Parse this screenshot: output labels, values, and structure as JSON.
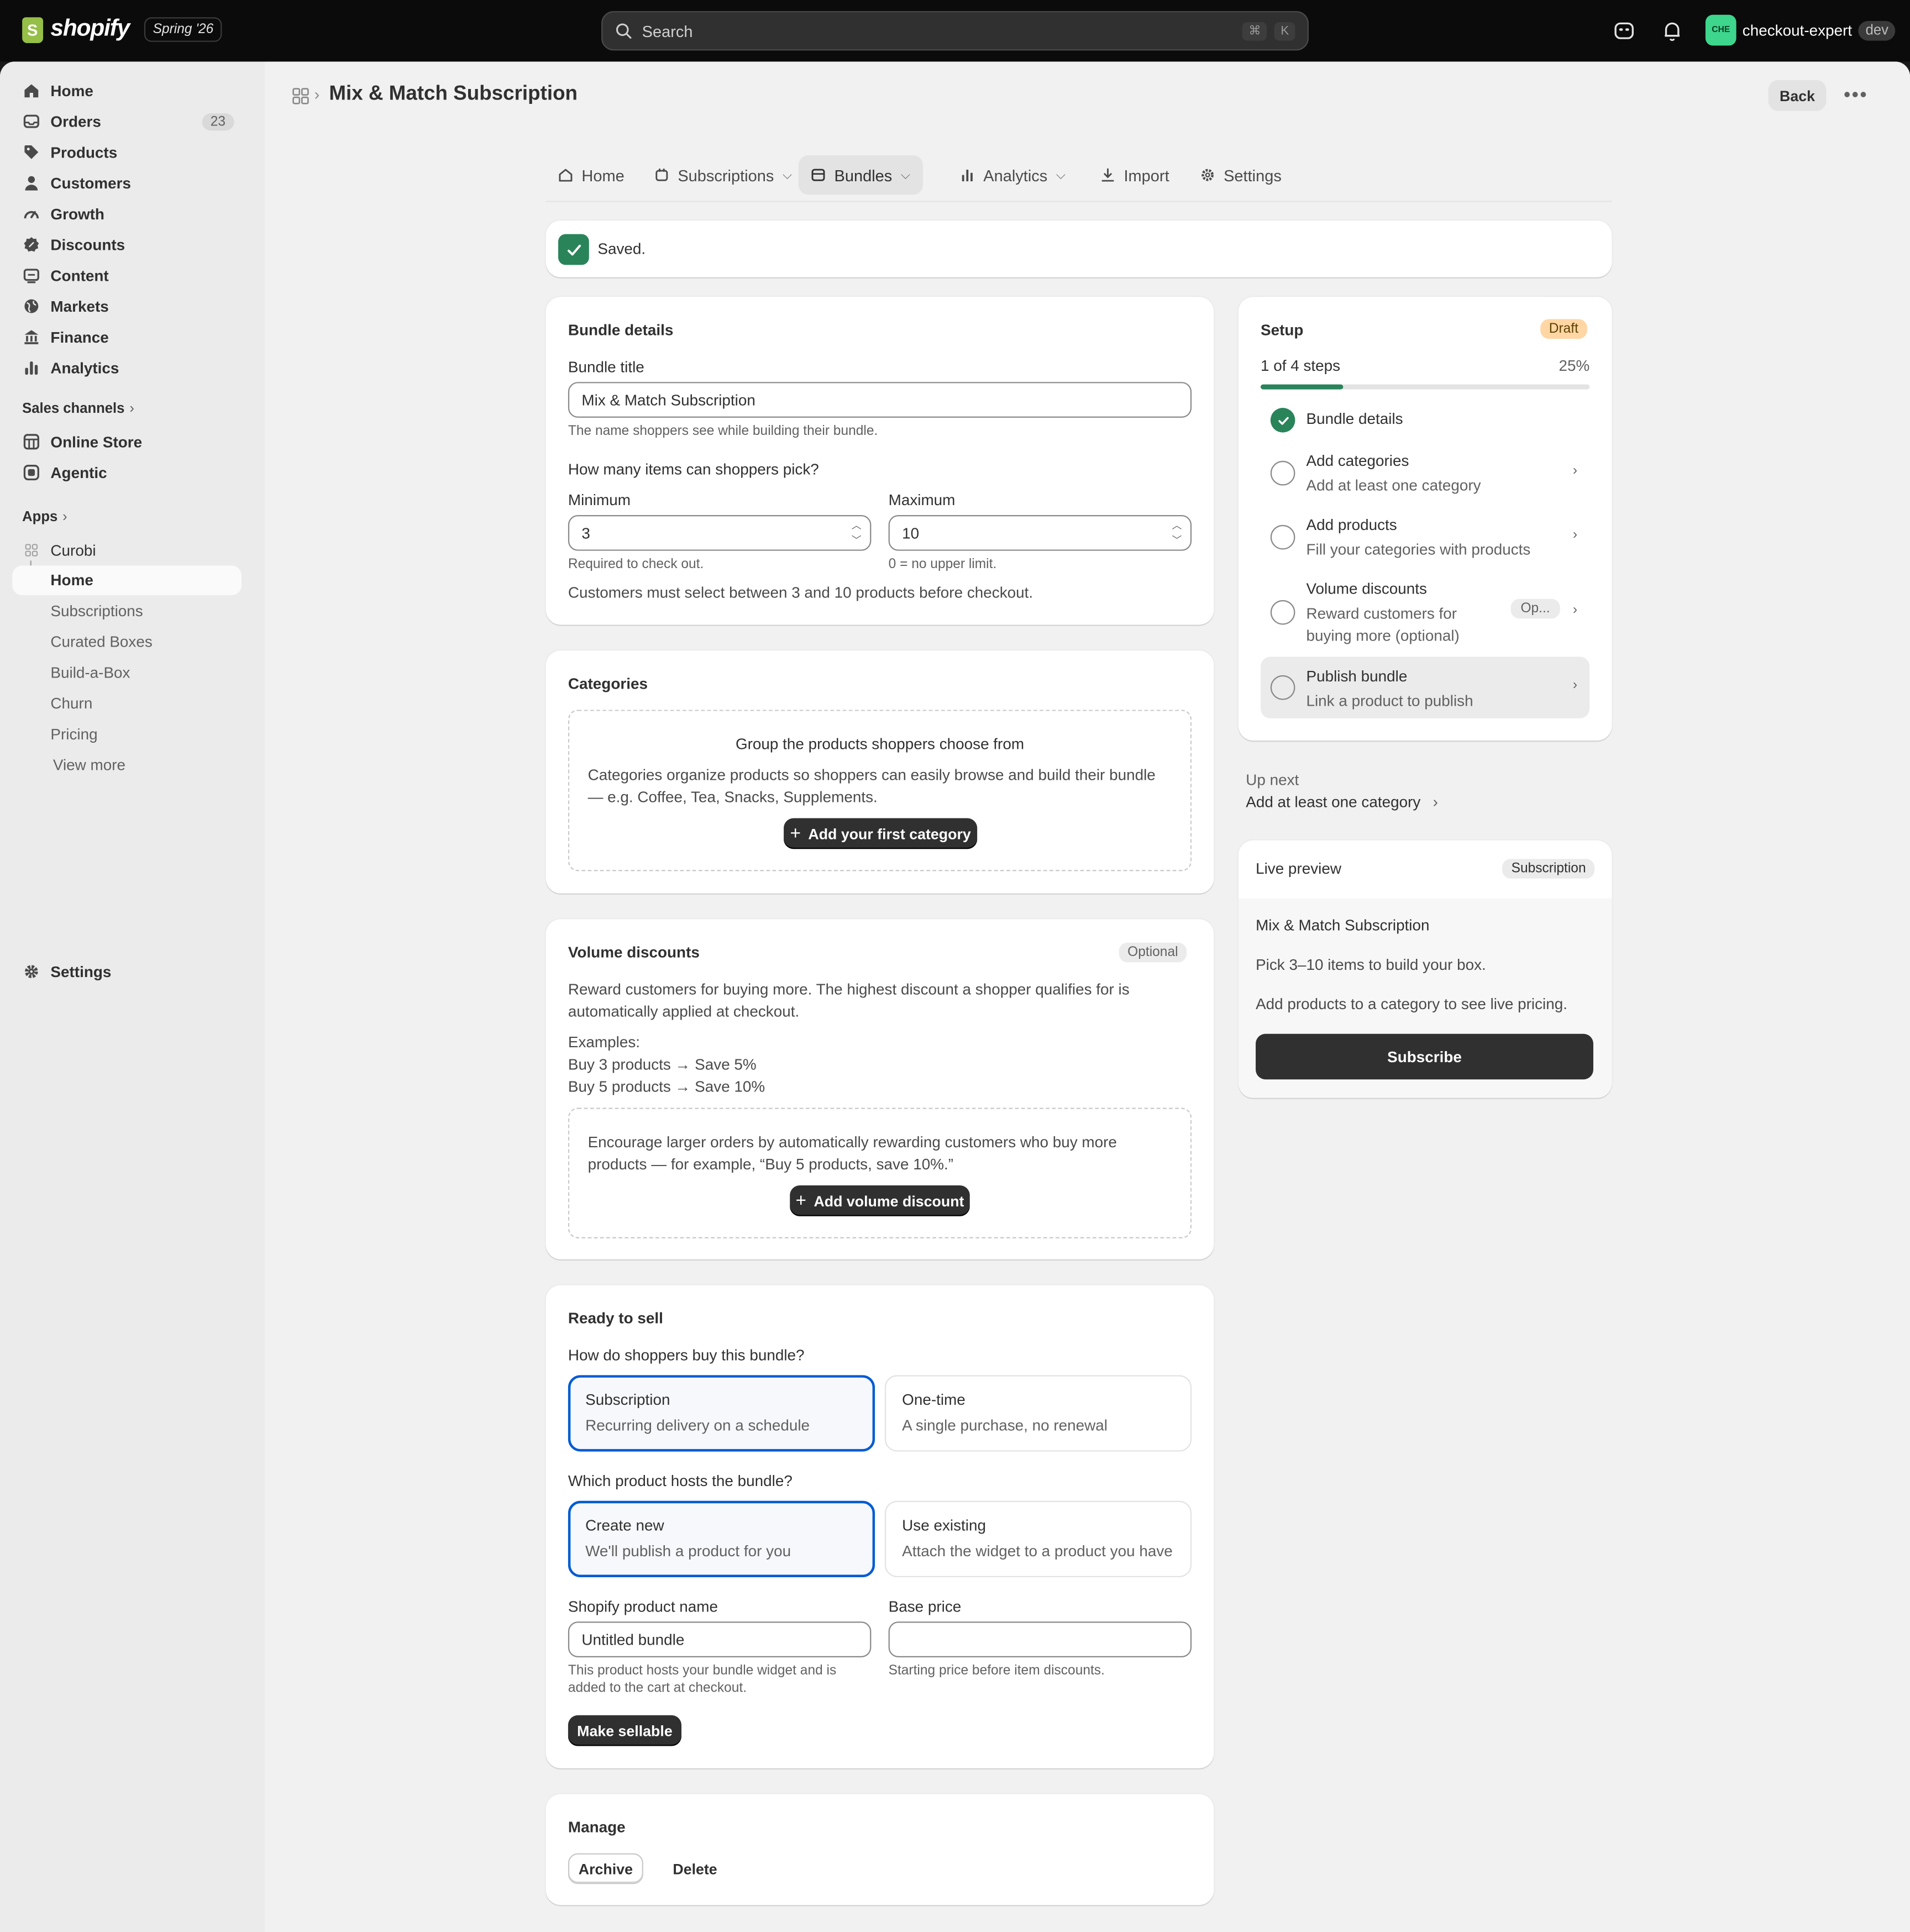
{
  "topbar": {
    "brand": "shopify",
    "edition": "Spring '26",
    "search_placeholder": "Search",
    "shortcut_cmd": "⌘",
    "shortcut_key": "K",
    "account_initials": "CHE",
    "account_name": "checkout-expert",
    "account_env": "dev"
  },
  "sidebar": {
    "items": [
      {
        "label": "Home",
        "icon": "home-icon"
      },
      {
        "label": "Orders",
        "icon": "inbox-icon",
        "badge": "23"
      },
      {
        "label": "Products",
        "icon": "tag-icon"
      },
      {
        "label": "Customers",
        "icon": "person-icon"
      },
      {
        "label": "Growth",
        "icon": "gauge-icon"
      },
      {
        "label": "Discounts",
        "icon": "discount-icon"
      },
      {
        "label": "Content",
        "icon": "content-icon"
      },
      {
        "label": "Markets",
        "icon": "globe-icon"
      },
      {
        "label": "Finance",
        "icon": "bank-icon"
      },
      {
        "label": "Analytics",
        "icon": "bar-chart-icon"
      }
    ],
    "sales_channels_label": "Sales channels",
    "channels": [
      {
        "label": "Online Store",
        "icon": "store-icon"
      },
      {
        "label": "Agentic",
        "icon": "agent-icon"
      }
    ],
    "apps_label": "Apps",
    "app_name": "Curobi",
    "app_pages": [
      "Home",
      "Subscriptions",
      "Curated Boxes",
      "Build-a-Box",
      "Churn",
      "Pricing"
    ],
    "view_more": "View more",
    "settings": "Settings"
  },
  "header": {
    "title": "Mix & Match Subscription",
    "back": "Back"
  },
  "tabs": [
    {
      "label": "Home",
      "icon": "home-icon"
    },
    {
      "label": "Subscriptions",
      "icon": "subscription-icon"
    },
    {
      "label": "Bundles",
      "icon": "bundle-icon"
    },
    {
      "label": "Analytics",
      "icon": "bar-chart-icon"
    },
    {
      "label": "Import",
      "icon": "import-icon"
    },
    {
      "label": "Settings",
      "icon": "gear-icon"
    }
  ],
  "banner": {
    "text": "Saved."
  },
  "bundle_details": {
    "title": "Bundle details",
    "title_label": "Bundle title",
    "title_value": "Mix & Match Subscription",
    "title_help": "The name shoppers see while building their bundle.",
    "items_question": "How many items can shoppers pick?",
    "min_label": "Minimum",
    "min_value": "3",
    "min_help": "Required to check out.",
    "max_label": "Maximum",
    "max_value": "10",
    "max_help": "0 = no upper limit.",
    "summary": "Customers must select between 3 and 10 products before checkout."
  },
  "categories": {
    "title": "Categories",
    "empty_title": "Group the products shoppers choose from",
    "empty_line1": "Categories organize products so shoppers can easily browse and build their bundle",
    "empty_line2": "— e.g. Coffee, Tea, Snacks, Supplements.",
    "add_button": "Add your first category"
  },
  "volume": {
    "title": "Volume discounts",
    "badge": "Optional",
    "desc_line1": "Reward customers for buying more. The highest discount a shopper qualifies for is",
    "desc_line2": "automatically applied at checkout.",
    "examples_label": "Examples:",
    "example1": "Buy 3 products → Save 5%",
    "example2": "Buy 5 products → Save 10%",
    "empty_line1": "Encourage larger orders by automatically rewarding customers who buy more",
    "empty_line2": "products — for example, “Buy 5 products, save 10%.”",
    "add_button": "Add volume discount"
  },
  "ready": {
    "title": "Ready to sell",
    "buy_question": "How do shoppers buy this bundle?",
    "opt_sub_title": "Subscription",
    "opt_sub_desc": "Recurring delivery on a schedule",
    "opt_one_title": "One-time",
    "opt_one_desc": "A single purchase, no renewal",
    "host_question": "Which product hosts the bundle?",
    "opt_new_title": "Create new",
    "opt_new_desc": "We'll publish a product for you",
    "opt_existing_title": "Use existing",
    "opt_existing_desc": "Attach the widget to a product you have",
    "product_name_label": "Shopify product name",
    "product_name_value": "Untitled bundle",
    "product_help_line1": "This product hosts your bundle widget and is",
    "product_help_line2": "added to the cart at checkout.",
    "price_label": "Base price",
    "price_value": "",
    "price_help": "Starting price before item discounts.",
    "make_sellable": "Make sellable"
  },
  "manage": {
    "title": "Manage",
    "archive": "Archive",
    "delete": "Delete"
  },
  "setup": {
    "title": "Setup",
    "status": "Draft",
    "progress_text": "1 of 4 steps",
    "progress_pct": "25%",
    "progress_value": 0.25,
    "steps": [
      {
        "title": "Bundle details",
        "desc": "",
        "done": true
      },
      {
        "title": "Add categories",
        "desc": "Add at least one category"
      },
      {
        "title": "Add products",
        "desc": "Fill your categories with products"
      },
      {
        "title": "Volume discounts",
        "desc1": "Reward customers for",
        "desc2": "buying more (optional)",
        "tag": "Op..."
      },
      {
        "title": "Publish bundle",
        "desc": "Link a product to publish"
      }
    ]
  },
  "up_next": {
    "label": "Up next",
    "link": "Add at least one category"
  },
  "preview": {
    "title": "Live preview",
    "badge": "Subscription",
    "bundle_name": "Mix & Match Subscription",
    "pick_text": "Pick 3–10 items to build your box.",
    "pricing_text": "Add products to a category to see live pricing.",
    "cta": "Subscribe"
  },
  "colors": {
    "accent_green": "#29845a",
    "selected_blue": "#005bd3",
    "draft_badge": "#ffd6a4",
    "dark_button": "#303030"
  }
}
